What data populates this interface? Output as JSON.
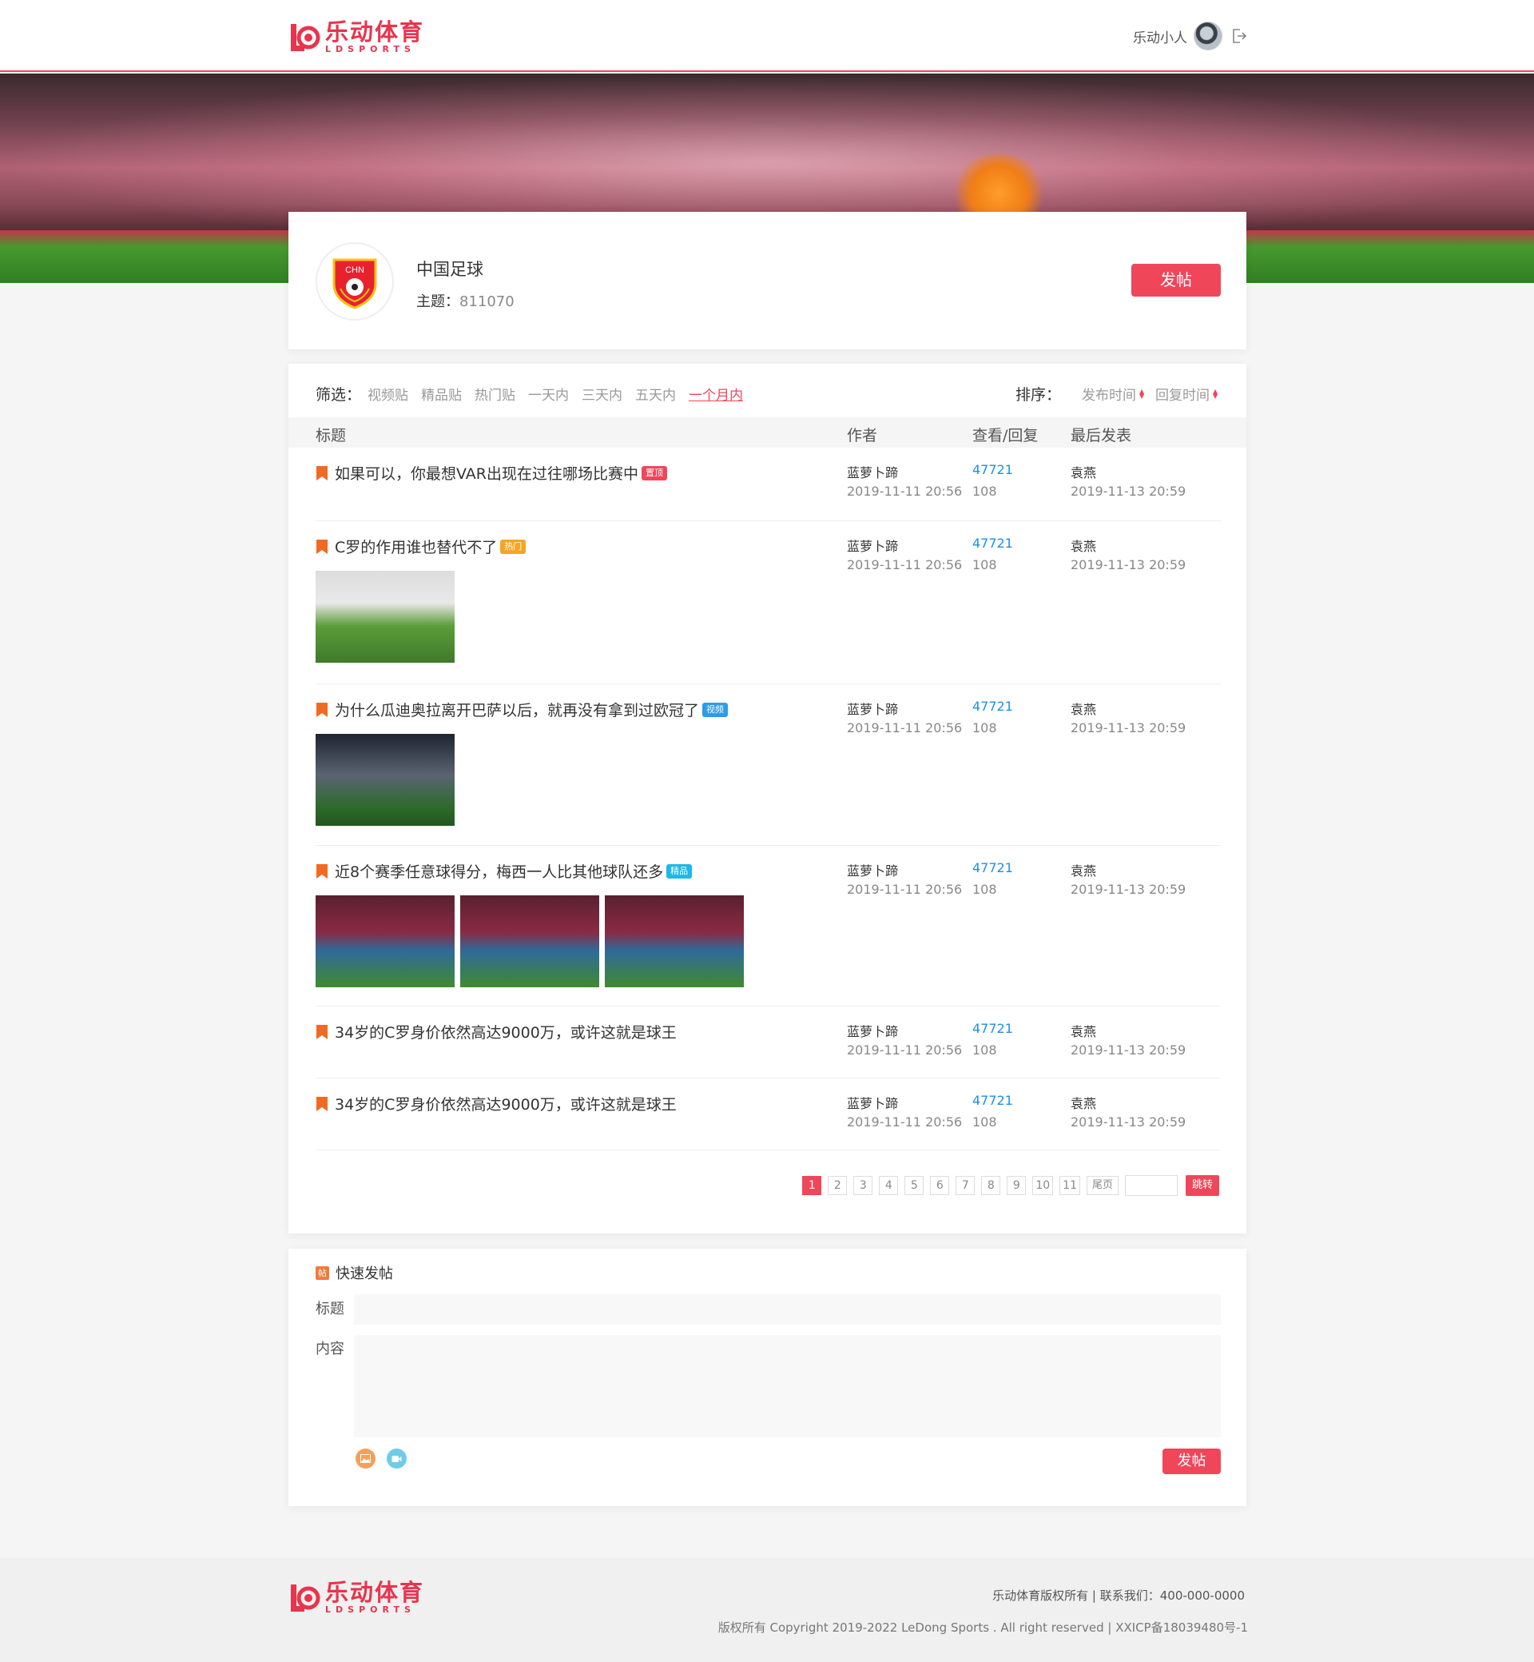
{
  "brand": {
    "name_cn": "乐动体育",
    "name_en": "LDSPORTS",
    "color": "#e8344d"
  },
  "header": {
    "username": "乐动小人",
    "logout_icon": "logout-icon"
  },
  "board": {
    "emblem_text": "CHN",
    "name": "中国足球",
    "topic_label": "主题：",
    "topic_count": "811070",
    "post_button": "发帖"
  },
  "filters": {
    "label": "筛选：",
    "items": [
      "视频贴",
      "精品贴",
      "热门贴",
      "一天内",
      "三天内",
      "五天内",
      "一个月内"
    ],
    "active": "一个月内"
  },
  "sort": {
    "label": "排序：",
    "items": [
      "发布时间",
      "回复时间"
    ]
  },
  "columns": {
    "title": "标题",
    "author": "作者",
    "views": "查看/回复",
    "last": "最后发表"
  },
  "posts": [
    {
      "title": "如果可以，你最想VAR出现在过往哪场比赛中",
      "tag": "置顶",
      "tag_color": "#f0465a",
      "author": "蓝萝卜蹄",
      "time": "2019-11-11 20:56",
      "views": "47721",
      "replies": "108",
      "last_user": "袁燕",
      "last_time": "2019-11-13 20:59",
      "images": 0
    },
    {
      "title": "C罗的作用谁也替代不了",
      "tag": "热门",
      "tag_color": "#f5a623",
      "author": "蓝萝卜蹄",
      "time": "2019-11-11 20:56",
      "views": "47721",
      "replies": "108",
      "last_user": "袁燕",
      "last_time": "2019-11-13 20:59",
      "images": 1
    },
    {
      "title": "为什么瓜迪奥拉离开巴萨以后，就再没有拿到过欧冠了",
      "tag": "视频",
      "tag_color": "#2f9be8",
      "author": "蓝萝卜蹄",
      "time": "2019-11-11 20:56",
      "views": "47721",
      "replies": "108",
      "last_user": "袁燕",
      "last_time": "2019-11-13 20:59",
      "images": 1
    },
    {
      "title": "近8个赛季任意球得分，梅西一人比其他球队还多",
      "tag": "精品",
      "tag_color": "#1fb7e8",
      "author": "蓝萝卜蹄",
      "time": "2019-11-11 20:56",
      "views": "47721",
      "replies": "108",
      "last_user": "袁燕",
      "last_time": "2019-11-13 20:59",
      "images": 3
    },
    {
      "title": "34岁的C罗身价依然高达9000万，或许这就是球王",
      "tag": "",
      "tag_color": "",
      "author": "蓝萝卜蹄",
      "time": "2019-11-11 20:56",
      "views": "47721",
      "replies": "108",
      "last_user": "袁燕",
      "last_time": "2019-11-13 20:59",
      "images": 0
    },
    {
      "title": "34岁的C罗身价依然高达9000万，或许这就是球王",
      "tag": "",
      "tag_color": "",
      "author": "蓝萝卜蹄",
      "time": "2019-11-11 20:56",
      "views": "47721",
      "replies": "108",
      "last_user": "袁燕",
      "last_time": "2019-11-13 20:59",
      "images": 0
    }
  ],
  "pagination": {
    "pages": [
      "1",
      "2",
      "3",
      "4",
      "5",
      "6",
      "7",
      "8",
      "9",
      "10",
      "11"
    ],
    "current": "1",
    "last_label": "尾页",
    "go_label": "跳转"
  },
  "quick_post": {
    "icon_text": "帖",
    "heading": "快速发帖",
    "title_label": "标题",
    "content_label": "内容",
    "submit": "发帖"
  },
  "footer": {
    "line1": "乐动体育版权所有 | 联系我们：400-000-0000",
    "line2": "版权所有 Copyright 2019-2022 LeDong Sports . All right reserved | XXICP备18039480号-1"
  }
}
